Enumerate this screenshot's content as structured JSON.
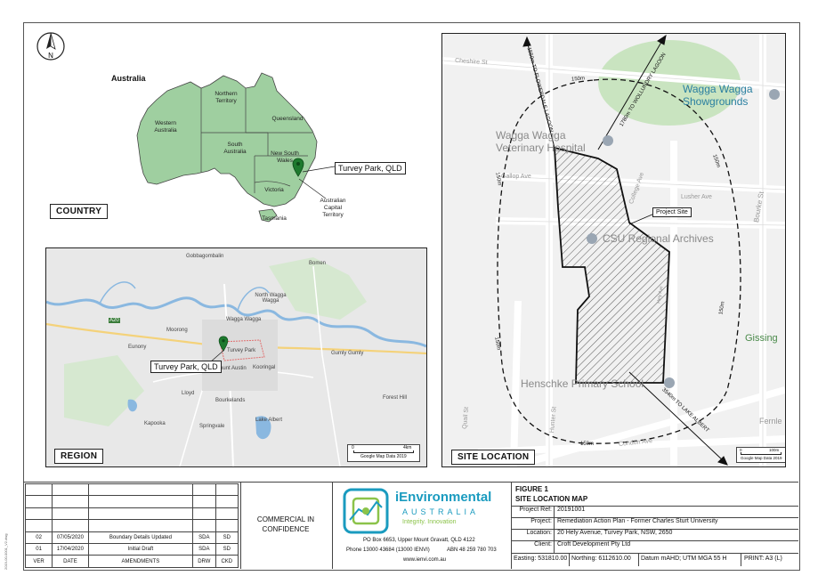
{
  "country_panel": {
    "label": "COUNTRY",
    "north_letter": "N",
    "map_title": "Australia",
    "regions": {
      "wa": "Western Australia",
      "nt": "Northern Territory",
      "qld": "Queensland",
      "sa": "South Australia",
      "nsw": "New South Wales",
      "vic": "Victoria",
      "tas": "Tasmania",
      "act": "Australian Capital Territory"
    },
    "marker_label": "Turvey Park, QLD"
  },
  "region_panel": {
    "label": "REGION",
    "marker_label": "Turvey Park, QLD",
    "places": {
      "gobbagombalin": "Gobbagombalin",
      "bomen": "Bomen",
      "north_wagga": "North Wagga Wagga",
      "wagga": "Wagga Wagga",
      "moorong": "Moorong",
      "eunony": "Eunony",
      "gumly": "Gumly Gumly",
      "turvey": "Turvey Park",
      "mount_austin": "Mount Austin",
      "kooringal": "Kooringal",
      "lloyd": "Lloyd",
      "bourkelands": "Bourkelands",
      "forest_hill": "Forest Hill",
      "kapooka": "Kapooka",
      "springvale": "Springvale",
      "lake_albert": "Lake Albert",
      "road": "A20"
    },
    "scale_left": "0",
    "scale_right": "4km",
    "attribution": "Google Map Data 2019"
  },
  "site_panel": {
    "label": "SITE LOCATION",
    "streets": {
      "cheshire": "Cheshire St",
      "gallop": "Gallop Ave",
      "lusher": "Lusher Ave",
      "college": "College Ave",
      "bourke": "Bourke St",
      "quail": "Quail St",
      "hunter": "Hunter St",
      "condon": "Condon Ave",
      "hely": "Hely Ave",
      "fernle": "Fernle",
      "gissing": "Gissing"
    },
    "pois": {
      "showgrounds": "Wagga Wagga Showgrounds",
      "vet": "Wagga Wagga Veterinary Hospital",
      "archives": "CSU Regional Archives",
      "school": "Henschke Primary School"
    },
    "buffer_label": "150m",
    "arrow_labels": {
      "flowerdale": "1550m TO FLOWERDALE LAGOON",
      "wollundry": "1780m TO WOLLUNDRY LAGOON",
      "lake_albert": "3540m TO LAKE ALBERT"
    },
    "project_site_label": "Project Site",
    "scale_left": "0",
    "scale_right": "100m",
    "attribution": "Google Map Data 2019"
  },
  "revisions": {
    "rows": [
      {
        "ver": "02",
        "date": "07/05/2020",
        "amend": "Boundary Details Updated",
        "drw": "SDA",
        "ckd": "SD"
      },
      {
        "ver": "01",
        "date": "17/04/2020",
        "amend": "Initial Draft",
        "drw": "SDA",
        "ckd": "SD"
      }
    ],
    "headers": {
      "ver": "VER",
      "date": "DATE",
      "amend": "AMENDMENTS",
      "drw": "DRW",
      "ckd": "CKD"
    }
  },
  "confidence": "COMMERCIAL IN CONFIDENCE",
  "company": {
    "name": "iEnvironmental",
    "country": "AUSTRALIA",
    "tagline": "Integrity. Innovation",
    "address": "PO Box 6653, Upper Mount Gravatt, QLD 4122",
    "phone": "Phone 13000 43684 (13000 IENVI)",
    "abn": "ABN 48 259 780 703",
    "web": "www.ienvi.com.au"
  },
  "title_block": {
    "figure": "FIGURE 1",
    "title": "SITE LOCATION MAP",
    "project_ref_key": "Project Ref:",
    "project_ref": "20191001",
    "project_key": "Project:",
    "project": "Remediation Action Plan - Former Charles Sturt University",
    "location_key": "Location:",
    "location": "20 Hely Avenue, Turvey Park, NSW, 2650",
    "client_key": "Client:",
    "client": "Croft Development Pty Ltd",
    "easting": "Easting: 531810.00",
    "northing": "Northing: 6112610.00",
    "datum": "Datum mAHD; UTM MGA 55 H",
    "print": "PRINT:  A3 (L)"
  },
  "side_note": "2019-00-0001_V2.dwg",
  "colors": {
    "land_green": "#9fcfa0",
    "map_bg": "#e8e8e8",
    "river_blue": "#8ab8e0",
    "brand_teal": "#1a9bbf",
    "brand_green": "#8bc34a"
  }
}
